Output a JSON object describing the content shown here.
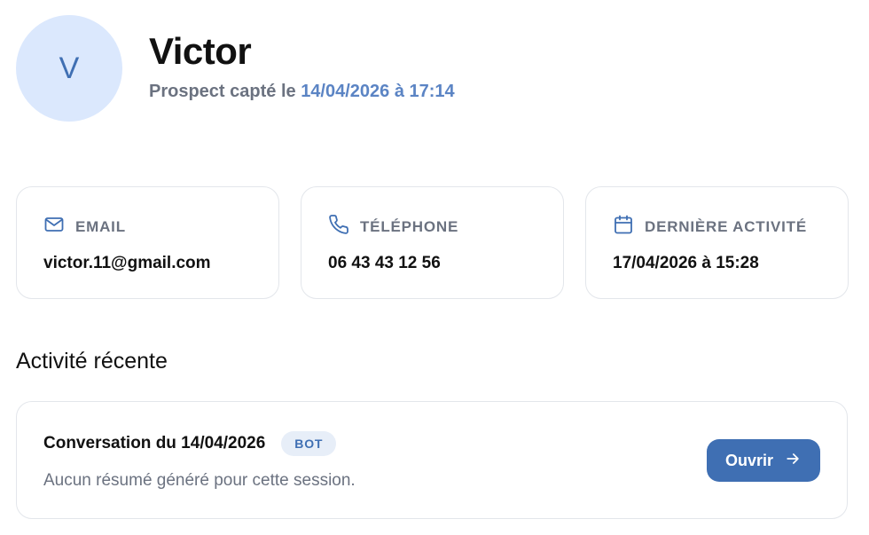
{
  "profile": {
    "initial": "V",
    "name": "Victor",
    "subtitle_prefix": "Prospect capté le",
    "captured_at": "14/04/2026 à 17:14"
  },
  "info_cards": [
    {
      "icon": "mail-icon",
      "label": "EMAIL",
      "value": "victor.11@gmail.com"
    },
    {
      "icon": "phone-icon",
      "label": "TÉLÉPHONE",
      "value": "06 43 43 12 56"
    },
    {
      "icon": "calendar-icon",
      "label": "DERNIÈRE ACTIVITÉ",
      "value": "17/04/2026 à 15:28"
    }
  ],
  "recent_activity": {
    "title": "Activité récente",
    "items": [
      {
        "title": "Conversation du 14/04/2026",
        "badge": "BOT",
        "description": "Aucun résumé généré pour cette session.",
        "button_label": "Ouvrir",
        "button_icon": "arrow-right-icon"
      }
    ]
  },
  "colors": {
    "accent": "#3f6fb3",
    "avatar_bg": "#dbe8fd",
    "muted_text": "#6b7280",
    "date_highlight": "#5b84c4",
    "border": "#e3e6eb"
  }
}
